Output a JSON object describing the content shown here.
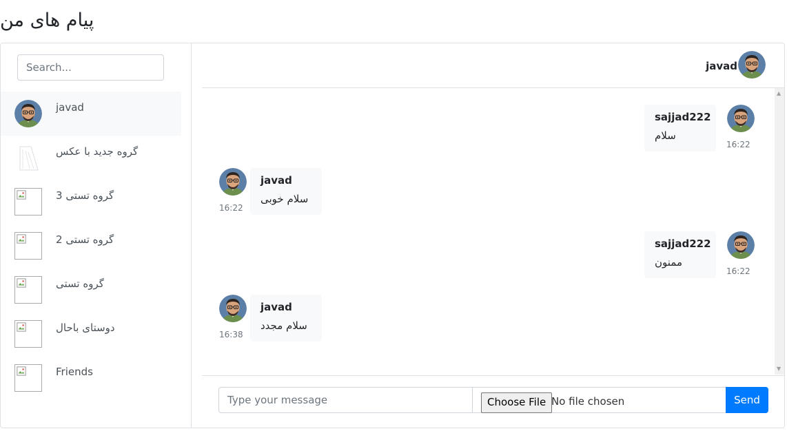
{
  "page": {
    "title": "پیام های من"
  },
  "search": {
    "placeholder": "Search..."
  },
  "conversations": [
    {
      "name": "javad",
      "avatar": "face",
      "active": true
    },
    {
      "name": "گروه جدید با عکس",
      "avatar": "faded"
    },
    {
      "name": "گروه تستی 3",
      "avatar": "broken"
    },
    {
      "name": "گروه تستی 2",
      "avatar": "broken"
    },
    {
      "name": "گروه تستی",
      "avatar": "broken"
    },
    {
      "name": "دوستای باحال",
      "avatar": "broken"
    },
    {
      "name": "Friends",
      "avatar": "broken"
    }
  ],
  "chat": {
    "header_name": "javad",
    "messages": [
      {
        "sender": "sajjad222",
        "text": "سلام",
        "time": "16:22",
        "side": "right"
      },
      {
        "sender": "javad",
        "text": "سلام خوبی",
        "time": "16:22",
        "side": "left"
      },
      {
        "sender": "sajjad222",
        "text": "ممنون",
        "time": "16:22",
        "side": "right"
      },
      {
        "sender": "javad",
        "text": "سلام مجدد",
        "time": "16:38",
        "side": "left"
      }
    ]
  },
  "composer": {
    "placeholder": "Type your message",
    "choose_file_label": "Choose File",
    "no_file_text": "No file chosen",
    "send_label": "Send"
  },
  "colors": {
    "accent": "#007bff",
    "active_row": "#f8f9fa",
    "bubble": "#f8f9fa",
    "border": "#dee2e6"
  }
}
